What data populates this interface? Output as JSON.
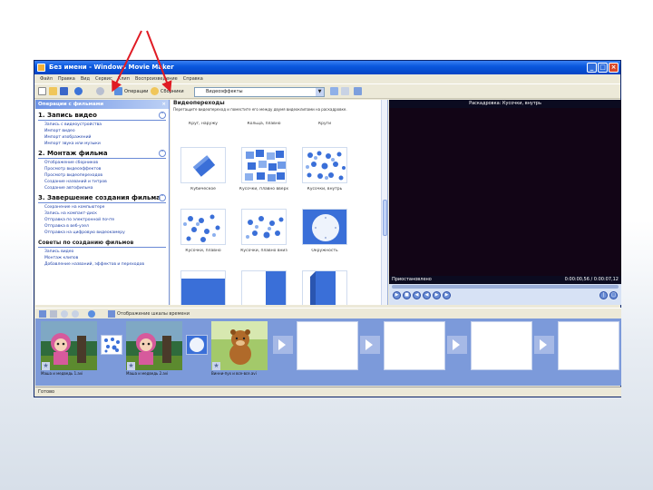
{
  "window": {
    "title": "Без имени - Windows Movie Maker",
    "menu": [
      "Файл",
      "Правка",
      "Вид",
      "Сервис",
      "Клип",
      "Воспроизведение",
      "Справка"
    ],
    "buttons": {
      "minimize": "_",
      "maximize": "□",
      "close": "×"
    }
  },
  "toolbar": {
    "tasks_label": "Операции",
    "collections_label": "Сборники",
    "collections_value": "Видеоэффекты"
  },
  "taskpane": {
    "header": "Операции с фильмами",
    "close": "×",
    "sections": [
      {
        "title": "1. Запись видео",
        "links": [
          "Запись с видеоустройства",
          "Импорт видео",
          "Импорт изображений",
          "Импорт звука или музыки"
        ]
      },
      {
        "title": "2. Монтаж фильма",
        "links": [
          "Отображение сборников",
          "Просмотр видеоэффектов",
          "Просмотр видеопереходов",
          "Создание названий и титров",
          "Создание автофильма"
        ]
      },
      {
        "title": "3. Завершение создания фильма",
        "links": [
          "Сохранение на компьютере",
          "Запись на компакт-диск",
          "Отправка по электронной почте",
          "Отправка в веб-узел",
          "Отправка на цифровую видеокамеру"
        ]
      }
    ],
    "tips_title": "Советы по созданию фильмов",
    "tips_links": [
      "Запись видео",
      "Монтаж клипов",
      "Добавление названий, эффектов и переходов"
    ]
  },
  "effects": {
    "header": "Видеопереходы",
    "description": "Перетащите видеопереход и поместите его между двумя видеоклипами на раскадровке.",
    "items": [
      {
        "label": "Круг, наружу"
      },
      {
        "label": "Кольца, плавно"
      },
      {
        "label": "Круги"
      },
      {
        "label": "Кубическое"
      },
      {
        "label": "Кусочки, плавно вверх"
      },
      {
        "label": "Кусочки, внутрь"
      },
      {
        "label": "Кусочки, плавно"
      },
      {
        "label": "Кусочки, плавно вниз"
      },
      {
        "label": "Окружность"
      }
    ]
  },
  "preview": {
    "title": "Раскадровка: Кусочки, внутрь",
    "status": "Приостановлено",
    "time": "0:00:00,56 / 0:00:07,12"
  },
  "storyboard": {
    "toolbar_label": "Отображение шкалы времени",
    "clips": [
      {
        "caption": "Маша и медведь 1.avi"
      },
      {
        "caption": "Маша и медведь 2.avi"
      },
      {
        "caption": "Винни-пух и все-все.avi"
      }
    ]
  },
  "statusbar": {
    "text": "Готово"
  },
  "colors": {
    "titlebar": "#0a58de",
    "storyboard": "#7c9ada",
    "annotation": "#e01b24",
    "preview_screen": "#120516"
  }
}
